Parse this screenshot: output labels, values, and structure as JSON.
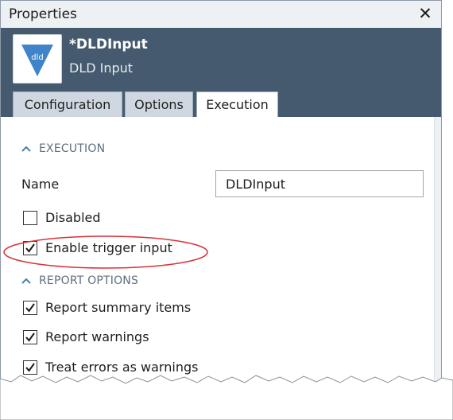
{
  "window": {
    "title": "Properties",
    "close_symbol": "✕"
  },
  "component": {
    "logo_text": "dld",
    "name": "*DLDInput",
    "subtitle": "DLD Input"
  },
  "tabs": [
    {
      "label": "Configuration",
      "active": false
    },
    {
      "label": "Options",
      "active": false
    },
    {
      "label": "Execution",
      "active": true
    }
  ],
  "sections": {
    "execution": {
      "title": "EXECUTION",
      "name_label": "Name",
      "name_value": "DLDInput",
      "disabled": {
        "label": "Disabled",
        "checked": false
      },
      "enable_trigger": {
        "label": "Enable trigger input",
        "checked": true
      }
    },
    "report_options": {
      "title": "REPORT OPTIONS",
      "summary": {
        "label": "Report summary items",
        "checked": true
      },
      "warnings": {
        "label": "Report warnings",
        "checked": true
      },
      "errors_as_warnings": {
        "label": "Treat errors as warnings",
        "checked": true
      }
    }
  },
  "colors": {
    "header_bg": "#455a6e",
    "highlight_ellipse": "#d8323c",
    "logo_blue": "#3f84c8"
  },
  "icons": {
    "close": "close-icon",
    "logo": "dld-logo-icon",
    "chevron": "chevron-up-icon",
    "check": "checkmark-icon"
  }
}
